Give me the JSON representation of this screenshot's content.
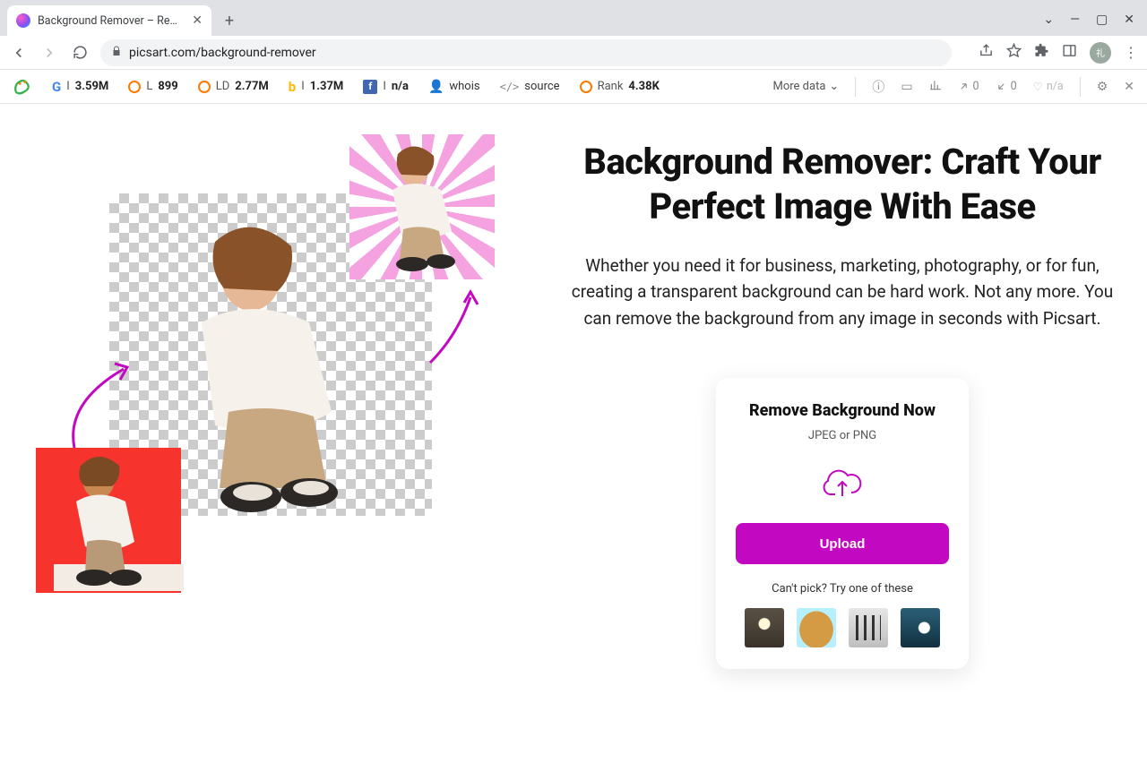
{
  "browser": {
    "tab_title": "Background Remover – Remove |",
    "url": "picsart.com/background-remover"
  },
  "seo_toolbar": {
    "google_index": "3.59M",
    "l_label": "L",
    "l_value": "899",
    "ld_label": "LD",
    "ld_value": "2.77M",
    "bing_index": "1.37M",
    "facebook_label": "I",
    "facebook_value": "n/a",
    "whois": "whois",
    "source": "source",
    "rank_label": "Rank",
    "rank_value": "4.38K",
    "more_data": "More data",
    "external_count": "0",
    "internal_count": "0",
    "heart": "n/a"
  },
  "page": {
    "headline": "Background Remover: Craft Your Perfect Image With Ease",
    "subtext": "Whether you need it for business, marketing, photography, or for fun, creating a transparent background can be hard work. Not any more. You can remove the background from any image in seconds with Picsart."
  },
  "card": {
    "title": "Remove Background Now",
    "subtitle": "JPEG or PNG",
    "button": "Upload",
    "cant_pick": "Can't pick? Try one of these"
  }
}
